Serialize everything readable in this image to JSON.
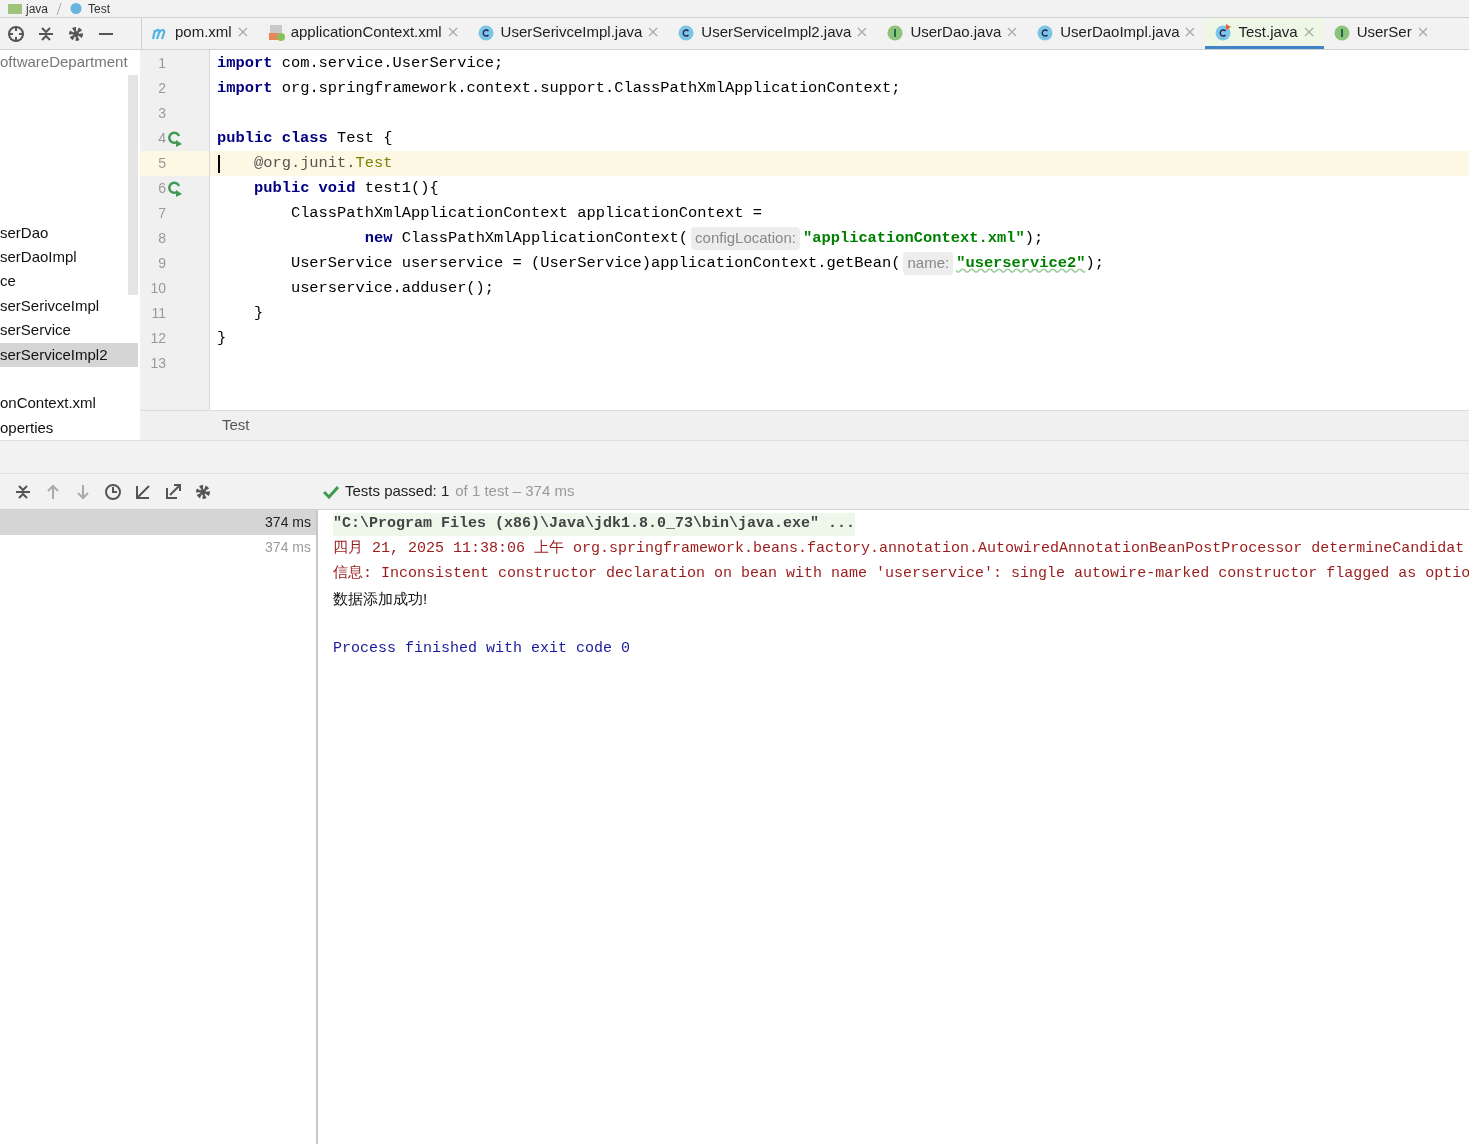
{
  "breadcrumb": [
    "java",
    "Test"
  ],
  "tabs": [
    {
      "label": "pom.xml",
      "kind": "maven",
      "selected": false
    },
    {
      "label": "applicationContext.xml",
      "kind": "xml",
      "selected": false
    },
    {
      "label": "UserSerivceImpl.java",
      "kind": "class",
      "selected": false
    },
    {
      "label": "UserServiceImpl2.java",
      "kind": "class",
      "selected": false
    },
    {
      "label": "UserDao.java",
      "kind": "interface",
      "selected": false
    },
    {
      "label": "UserDaoImpl.java",
      "kind": "class",
      "selected": false
    },
    {
      "label": "Test.java",
      "kind": "test",
      "selected": true
    },
    {
      "label": "UserSer",
      "kind": "interface",
      "selected": false
    }
  ],
  "project_tree": [
    {
      "label": "oftwareDepartment",
      "selected": false,
      "dim": true
    },
    {
      "label": "serDao",
      "selected": false,
      "dim": false
    },
    {
      "label": "serDaoImpl",
      "selected": false,
      "dim": false
    },
    {
      "label": "ce",
      "selected": false,
      "dim": false
    },
    {
      "label": "serSerivceImpl",
      "selected": false,
      "dim": false
    },
    {
      "label": "serService",
      "selected": false,
      "dim": false
    },
    {
      "label": "serServiceImpl2",
      "selected": true,
      "dim": false
    },
    {
      "label": "onContext.xml",
      "selected": false,
      "dim": false
    },
    {
      "label": "operties",
      "selected": false,
      "dim": false
    }
  ],
  "editor": {
    "lines": [
      {
        "number": "1",
        "current": false,
        "run": false,
        "tokens": [
          {
            "kind": "keyword",
            "text": "import"
          },
          {
            "kind": "plain",
            "text": " com.service.UserService;"
          }
        ]
      },
      {
        "number": "2",
        "current": false,
        "run": false,
        "tokens": [
          {
            "kind": "keyword",
            "text": "import"
          },
          {
            "kind": "plain",
            "text": " org.springframework.context.support.ClassPathXmlApplicationContext;"
          }
        ]
      },
      {
        "number": "3",
        "current": false,
        "run": false
      },
      {
        "number": "4",
        "current": false,
        "run": true,
        "tokens": [
          {
            "kind": "keyword",
            "text": "public class"
          },
          {
            "kind": "plain",
            "text": " Test {"
          }
        ]
      },
      {
        "number": "5",
        "current": true,
        "run": false,
        "tokens": [
          {
            "kind": "annotation",
            "text": "    @org.junit."
          },
          {
            "kind": "annotation-name",
            "text": "Test"
          }
        ]
      },
      {
        "number": "6",
        "current": false,
        "run": true,
        "tokens": [
          {
            "kind": "keyword",
            "text": "    public void"
          },
          {
            "kind": "plain",
            "text": " test1(){"
          }
        ]
      },
      {
        "number": "7",
        "current": false,
        "run": false,
        "tokens": [
          {
            "kind": "plain",
            "text": "        ClassPathXmlApplicationContext applicationContext ="
          }
        ]
      },
      {
        "number": "8",
        "current": false,
        "run": false,
        "tokens": [
          {
            "kind": "keyword",
            "text": "                new"
          },
          {
            "kind": "plain",
            "text": " ClassPathXmlApplicationContext("
          },
          {
            "kind": "hint",
            "text": "configLocation:"
          },
          {
            "kind": "string",
            "text": "\"applicationContext.xml\""
          },
          {
            "kind": "plain",
            "text": ");"
          }
        ]
      },
      {
        "number": "9",
        "current": false,
        "run": false,
        "tokens": [
          {
            "kind": "plain",
            "text": "        UserService userservice = (UserService)applicationContext.getBean("
          },
          {
            "kind": "hint",
            "text": "name:"
          },
          {
            "kind": "string",
            "text": "\"userservice2\""
          },
          {
            "kind": "plain",
            "text": ");"
          }
        ]
      },
      {
        "number": "10",
        "current": false,
        "run": false,
        "tokens": [
          {
            "kind": "plain",
            "text": "        userservice.adduser();"
          }
        ]
      },
      {
        "number": "11",
        "current": false,
        "run": false,
        "tokens": [
          {
            "kind": "plain",
            "text": "    }"
          }
        ]
      },
      {
        "number": "12",
        "current": false,
        "run": false,
        "tokens": [
          {
            "kind": "plain",
            "text": "}"
          }
        ]
      },
      {
        "number": "13",
        "current": false,
        "run": false
      }
    ],
    "breadcrumb": "Test"
  },
  "test_status": {
    "main": "Tests passed: 1",
    "detail": "of 1 test – 374 ms"
  },
  "test_tree": [
    {
      "time": "374 ms",
      "selected": true
    },
    {
      "time": "374 ms",
      "selected": false
    }
  ],
  "console": [
    {
      "kind": "command",
      "text": "\"C:\\Program Files (x86)\\Java\\jdk1.8.0_73\\bin\\java.exe\" ..."
    },
    {
      "kind": "error",
      "text": "四月 21, 2025 11:38:06 上午 org.springframework.beans.factory.annotation.AutowiredAnnotationBeanPostProcessor determineCandidat"
    },
    {
      "kind": "error",
      "text": "信息: Inconsistent constructor declaration on bean with name 'userservice': single autowire-marked constructor flagged as optio"
    },
    {
      "kind": "output",
      "text": "数据添加成功!"
    },
    {
      "kind": "blank"
    },
    {
      "kind": "exit",
      "text": "Process finished with exit code 0"
    }
  ]
}
